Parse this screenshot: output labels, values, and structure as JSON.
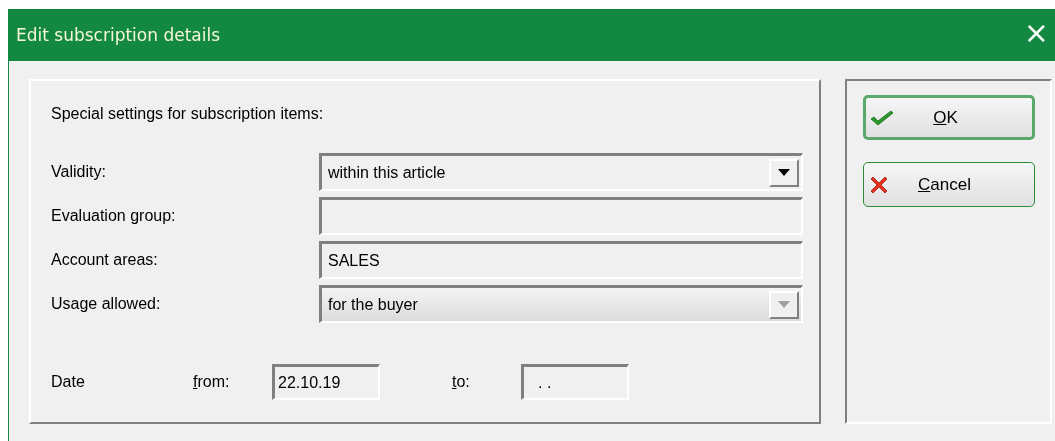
{
  "window": {
    "title": "Edit subscription details",
    "close": "×"
  },
  "settings": {
    "heading": "Special settings for subscription items:",
    "fields": [
      {
        "kind": "dropdown",
        "label": "Validity:",
        "value": "within this article",
        "disabled": false
      },
      {
        "kind": "text",
        "label": "Evaluation group:"
      },
      {
        "kind": "text",
        "label": "Account areas:",
        "value": "SALES"
      },
      {
        "kind": "dropdown",
        "label": "Usage allowed:",
        "value": "for the buyer",
        "disabled": true
      }
    ],
    "date": {
      "label": "Date",
      "from_label": "from:",
      "from_value": "22.10.19",
      "to_label": "to:",
      "to_value": ". ."
    }
  },
  "buttons": [
    {
      "kind": "ok",
      "label": "OK",
      "default": true
    },
    {
      "kind": "cancel",
      "label": "Cancel",
      "default": false
    }
  ]
}
